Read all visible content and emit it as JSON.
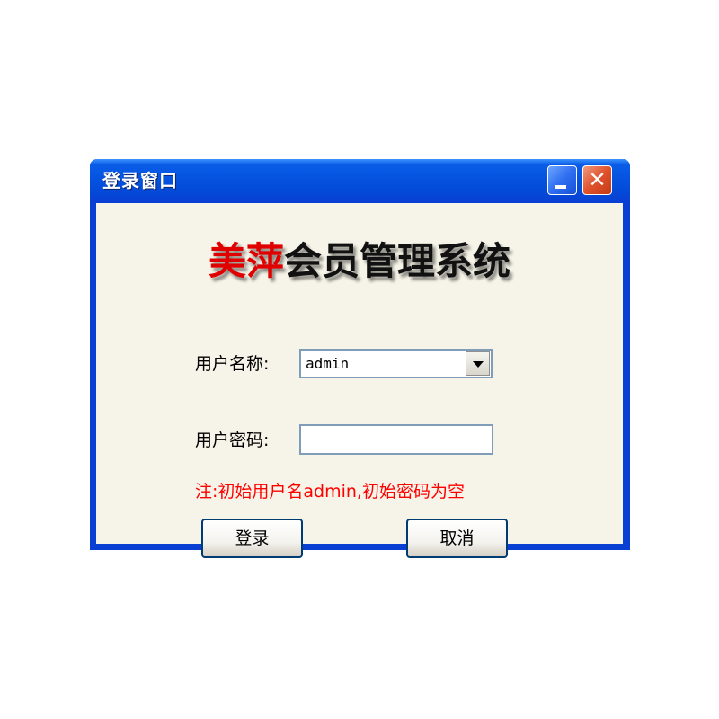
{
  "window": {
    "title": "登录窗口"
  },
  "titlebar_buttons": {
    "minimize_icon": "minimize-icon",
    "close_glyph": "✕"
  },
  "heading": {
    "part_red": "美萍",
    "part_black": "会员管理系统"
  },
  "form": {
    "username_label": "用户名称:",
    "username_value": "admin",
    "password_label": "用户密码:",
    "password_value": "",
    "note": "注:初始用户名admin,初始密码为空"
  },
  "buttons": {
    "login": "登录",
    "cancel": "取消"
  },
  "colors": {
    "titlebar": "#0a5de8",
    "client_bg": "#f6f4e8",
    "note_text": "#ff0000",
    "heading_red": "#e00000"
  }
}
